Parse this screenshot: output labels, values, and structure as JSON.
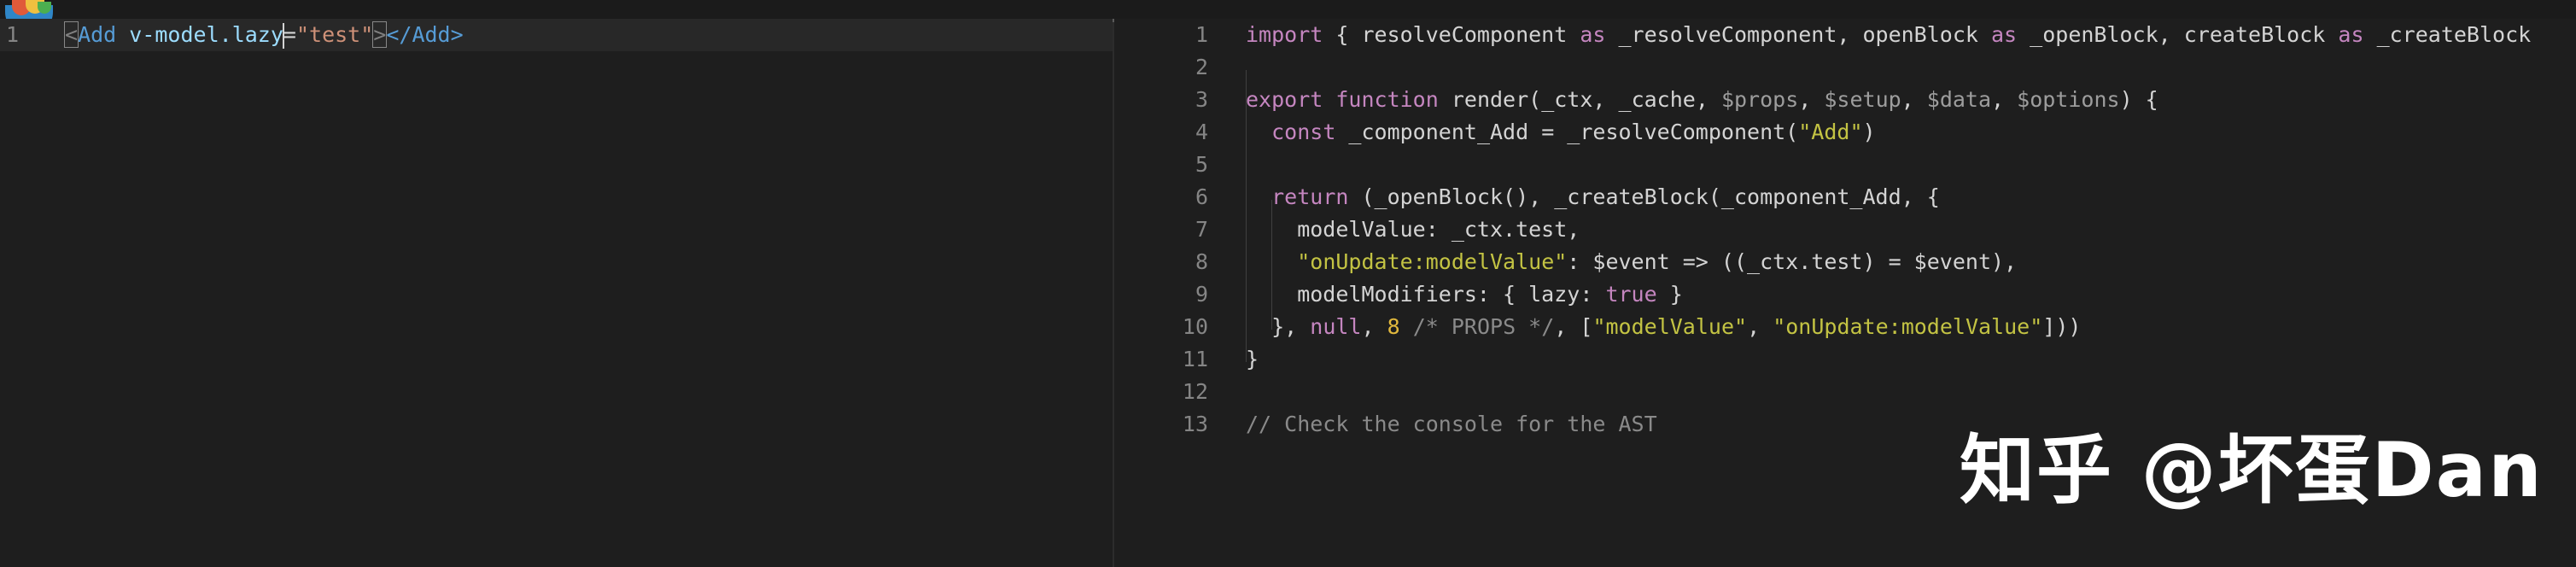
{
  "editor": {
    "source_line_number": "1",
    "source_tokens": {
      "open_lt": "<",
      "tag": "Add",
      "space": " ",
      "attr_name": "v-model.lazy",
      "eq": "=",
      "attr_value": "\"test\"",
      "open_gt": ">",
      "close_tag": "</Add>"
    }
  },
  "output": {
    "lines": [
      {
        "n": "1",
        "text": "import { resolveComponent as _resolveComponent, openBlock as _openBlock, createBlock as _createBlock"
      },
      {
        "n": "2",
        "text": ""
      },
      {
        "n": "3",
        "text": "export function render(_ctx, _cache, $props, $setup, $data, $options) {"
      },
      {
        "n": "4",
        "text": "  const _component_Add = _resolveComponent(\"Add\")"
      },
      {
        "n": "5",
        "text": ""
      },
      {
        "n": "6",
        "text": "  return (_openBlock(), _createBlock(_component_Add, {"
      },
      {
        "n": "7",
        "text": "    modelValue: _ctx.test,"
      },
      {
        "n": "8",
        "text": "    \"onUpdate:modelValue\": $event => ((_ctx.test) = $event),"
      },
      {
        "n": "9",
        "text": "    modelModifiers: { lazy: true }"
      },
      {
        "n": "10",
        "text": "  }, null, 8 /* PROPS */, [\"modelValue\", \"onUpdate:modelValue\"]))"
      },
      {
        "n": "11",
        "text": "}"
      },
      {
        "n": "12",
        "text": ""
      },
      {
        "n": "13",
        "text": "// Check the console for the AST"
      }
    ],
    "segments": {
      "l1": [
        "import",
        " { resolveComponent ",
        "as",
        " _resolveComponent, openBlock ",
        "as",
        " _openBlock, createBlock ",
        "as",
        " _createBlock"
      ],
      "l3": [
        "export",
        " ",
        "function",
        " render(_ctx, _cache, ",
        "$props",
        ", ",
        "$setup",
        ", ",
        "$data",
        ", ",
        "$options",
        ") {"
      ],
      "l4": [
        "  ",
        "const",
        " _component_Add = _resolveComponent(",
        "\"Add\"",
        ")"
      ],
      "l6": [
        "  ",
        "return",
        " (_openBlock(), _createBlock(_component_Add, {"
      ],
      "l7": [
        "    modelValue: _ctx.test,"
      ],
      "l8": [
        "    ",
        "\"onUpdate:modelValue\"",
        ": $event => ((_ctx.test) = $event),"
      ],
      "l9": [
        "    modelModifiers: { lazy: ",
        "true",
        " }"
      ],
      "l10": [
        "  }, ",
        "null",
        ", ",
        "8",
        " ",
        "/* PROPS */",
        ", [",
        "\"modelValue\"",
        ", ",
        "\"onUpdate:modelValue\"",
        "]))"
      ],
      "l11": [
        "}"
      ],
      "l13": [
        "// Check the console for the AST"
      ]
    }
  },
  "watermark": {
    "text": "知乎 @坏蛋Dan"
  },
  "colors": {
    "background": "#1e1e1e",
    "keyword": "#c586c0",
    "string": "#c3c343",
    "tag": "#569cd6",
    "attribute": "#9cdcfe",
    "attr_string": "#ce9178",
    "line_number": "#858585"
  },
  "icons": {
    "app_logo": "app-logo-icon"
  }
}
